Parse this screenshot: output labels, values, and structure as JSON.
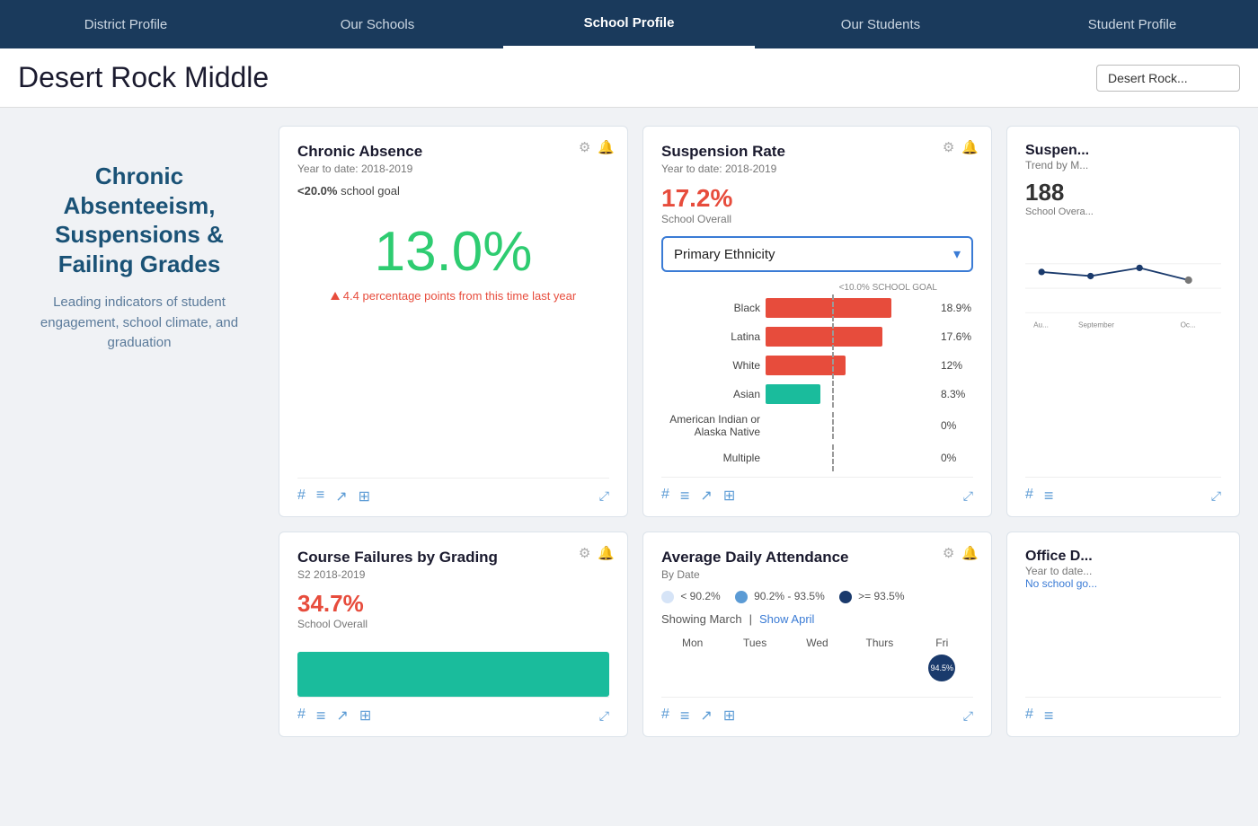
{
  "nav": {
    "items": [
      {
        "label": "District Profile",
        "active": false
      },
      {
        "label": "Our Schools",
        "active": false
      },
      {
        "label": "School Profile",
        "active": true
      },
      {
        "label": "Our Students",
        "active": false
      },
      {
        "label": "Student Profile",
        "active": false
      }
    ]
  },
  "header": {
    "title": "Desert Rock Middle",
    "school_selector": "Desert Rock..."
  },
  "left_panel": {
    "section_title": "Chronic Absenteeism, Suspensions & Failing Grades",
    "section_desc": "Leading indicators of student engagement, school climate, and graduation"
  },
  "cards": {
    "chronic_absence": {
      "title": "Chronic Absence",
      "subtitle": "Year to date: 2018-2019",
      "goal_label": "<20.0%",
      "goal_text": "school goal",
      "big_value": "13.0%",
      "change_text": "4.4 percentage points from this time last year",
      "settings_icon": "⚙",
      "alert_icon": "🔔"
    },
    "suspension_rate": {
      "title": "Suspension Rate",
      "subtitle": "Year to date: 2018-2019",
      "overall_value": "17.2%",
      "overall_label": "School Overall",
      "dropdown_label": "Primary Ethnicity",
      "goal_line_label": "<10.0% SCHOOL GOAL",
      "bars": [
        {
          "label": "Black",
          "value": 18.9,
          "display": "18.9%",
          "color": "#e74c3c",
          "max": 25
        },
        {
          "label": "Latina",
          "value": 17.6,
          "display": "17.6%",
          "color": "#e74c3c",
          "max": 25
        },
        {
          "label": "White",
          "value": 12,
          "display": "12%",
          "color": "#e74c3c",
          "max": 25
        },
        {
          "label": "Asian",
          "value": 8.3,
          "display": "8.3%",
          "color": "#1abc9c",
          "max": 25
        },
        {
          "label": "American Indian or Alaska Native",
          "value": 0,
          "display": "0%",
          "color": "#e74c3c",
          "max": 25
        },
        {
          "label": "Multiple",
          "value": 0,
          "display": "0%",
          "color": "#e74c3c",
          "max": 25
        }
      ],
      "goal_percent": 10,
      "settings_icon": "⚙",
      "alert_icon": "🔔"
    },
    "suspension_trend": {
      "title": "Suspen...",
      "subtitle": "Trend by M...",
      "overall_value": "188",
      "overall_label": "School Overa...",
      "x_labels": [
        "Au...",
        "September",
        "Oc..."
      ]
    },
    "course_failures": {
      "title": "Course Failures by Grading",
      "subtitle": "S2 2018-2019",
      "overall_value": "34.7%",
      "overall_label": "School Overall",
      "settings_icon": "⚙",
      "alert_icon": "🔔"
    },
    "average_daily_attendance": {
      "title": "Average Daily Attendance",
      "subtitle": "By Date",
      "legend": [
        {
          "label": "< 90.2%",
          "color": "#d6e4f7"
        },
        {
          "label": "90.2% - 93.5%",
          "color": "#5b9bd5"
        },
        {
          "label": ">= 93.5%",
          "color": "#1a3a6c"
        }
      ],
      "showing_march": "Showing March",
      "show_april": "Show April",
      "calendar_days": [
        "Mon",
        "Tues",
        "Wed",
        "Thurs",
        "Fri"
      ],
      "first_cell_value": "94.5%",
      "settings_icon": "⚙",
      "alert_icon": "🔔"
    },
    "office_d": {
      "title": "Office D...",
      "subtitle": "Year to date...",
      "no_goal": "No school go..."
    }
  },
  "icons": {
    "hashtag": "#",
    "bar_chart": "≡",
    "trend_line": "↗",
    "grid_chart": "⊞",
    "expand": "⤢",
    "settings": "⚙",
    "bell": "🔔",
    "chevron_down": "▾"
  }
}
